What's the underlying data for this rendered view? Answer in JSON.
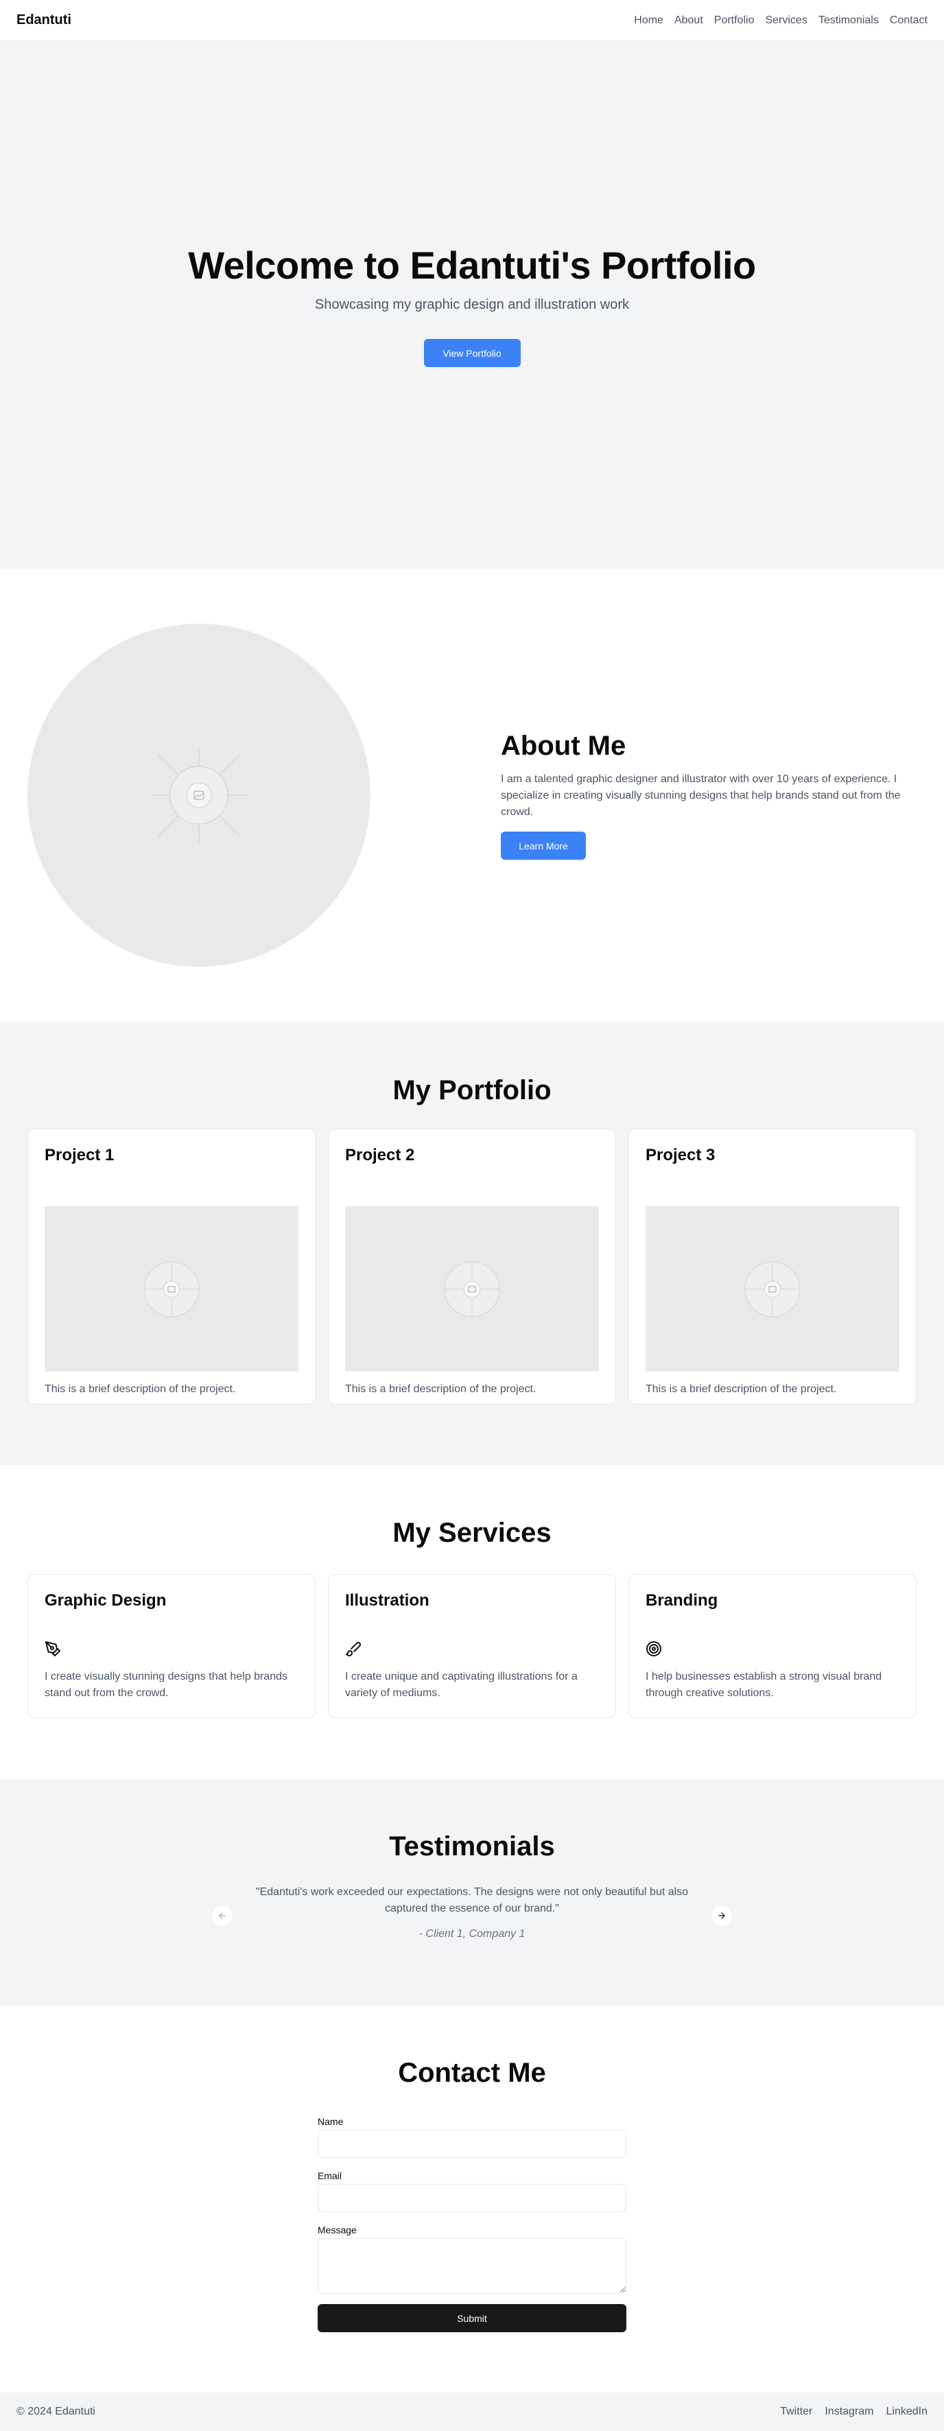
{
  "nav": {
    "brand": "Edantuti",
    "links": [
      "Home",
      "About",
      "Portfolio",
      "Services",
      "Testimonials",
      "Contact"
    ]
  },
  "hero": {
    "title": "Welcome to Edantuti's Portfolio",
    "subtitle": "Showcasing my graphic design and illustration work",
    "button": "View Portfolio"
  },
  "about": {
    "title": "About Me",
    "text": "I am a talented graphic designer and illustrator with over 10 years of experience. I specialize in creating visually stunning designs that help brands stand out from the crowd.",
    "button": "Learn More"
  },
  "portfolio": {
    "title": "My Portfolio",
    "projects": [
      {
        "title": "Project 1",
        "desc": "This is a brief description of the project."
      },
      {
        "title": "Project 2",
        "desc": "This is a brief description of the project."
      },
      {
        "title": "Project 3",
        "desc": "This is a brief description of the project."
      }
    ]
  },
  "services": {
    "title": "My Services",
    "items": [
      {
        "title": "Graphic Design",
        "icon": "pen-tool-icon",
        "desc": "I create visually stunning designs that help brands stand out from the crowd."
      },
      {
        "title": "Illustration",
        "icon": "brush-icon",
        "desc": "I create unique and captivating illustrations for a variety of mediums."
      },
      {
        "title": "Branding",
        "icon": "target-icon",
        "desc": "I help businesses establish a strong visual brand through creative solutions."
      }
    ]
  },
  "testimonials": {
    "title": "Testimonials",
    "quote": "\"Edantuti's work exceeded our expectations. The designs were not only beautiful but also captured the essence of our brand.\"",
    "author": "- Client 1, Company 1"
  },
  "contact": {
    "title": "Contact Me",
    "name_label": "Name",
    "email_label": "Email",
    "message_label": "Message",
    "submit": "Submit"
  },
  "footer": {
    "copyright": "© 2024 Edantuti",
    "links": [
      "Twitter",
      "Instagram",
      "LinkedIn"
    ]
  },
  "colors": {
    "accent": "#3b82f6",
    "section_bg": "#f3f4f6",
    "submit_bg": "#18181b"
  }
}
